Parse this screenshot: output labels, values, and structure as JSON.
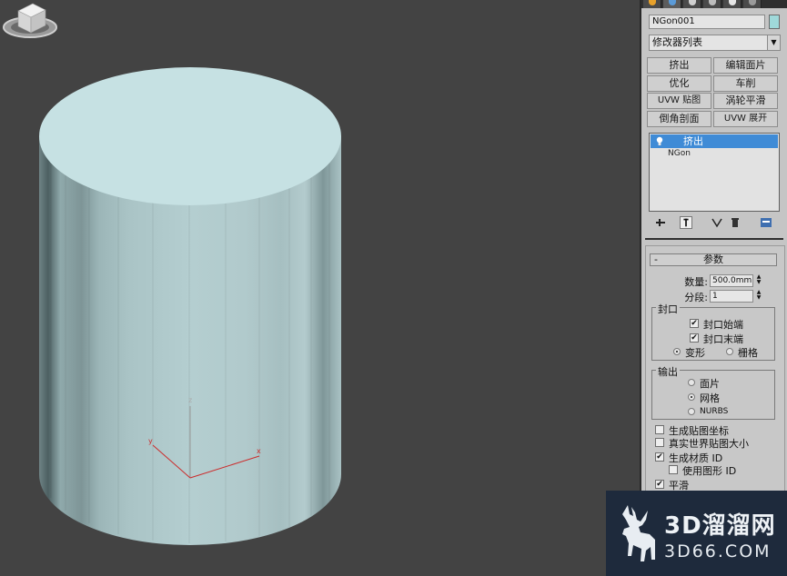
{
  "viewport": {
    "axis_labels": {
      "z": "z",
      "y": "y",
      "x": "x"
    }
  },
  "command_panel": {
    "object_name": "NGon001",
    "object_color": "#9fd9da",
    "modifier_list": "修改器列表",
    "modifier_buttons": [
      "挤出",
      "编辑面片",
      "优化",
      "车削",
      "UVW 贴图",
      "涡轮平滑",
      "倒角剖面",
      "UVW 展开"
    ],
    "stack": {
      "selected": "挤出",
      "base": "NGon"
    },
    "parameters": {
      "rollout_toggle": "-",
      "title": "参数",
      "amount_label": "数量:",
      "amount_value": "500.0mm",
      "segments_label": "分段:",
      "segments_value": "1",
      "capping": {
        "title": "封口",
        "cap_start": "封口始端",
        "cap_end": "封口末端",
        "morph": "变形",
        "grid": "栅格"
      },
      "output": {
        "title": "输出",
        "patch": "面片",
        "mesh": "网格",
        "nurbs": "NURBS"
      },
      "gen_map_coords": "生成贴图坐标",
      "real_world_map_size": "真实世界贴图大小",
      "gen_material_ids": "生成材质 ID",
      "use_shape_ids": "使用图形 ID",
      "smooth": "平滑"
    }
  },
  "watermark": {
    "line1": "3D溜溜网",
    "line2": "3D66.COM"
  }
}
